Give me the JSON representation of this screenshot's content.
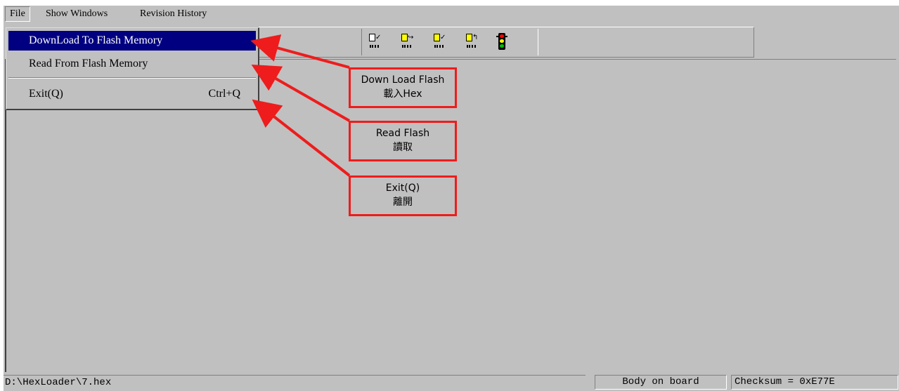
{
  "menubar": {
    "items": [
      {
        "label": "File"
      },
      {
        "label": "Show Windows"
      },
      {
        "label": "Revision History"
      }
    ]
  },
  "file_menu": {
    "items": [
      {
        "label": "DownLoad To Flash Memory",
        "shortcut": ""
      },
      {
        "label": "Read From Flash Memory",
        "shortcut": ""
      },
      {
        "label": "Exit(Q)",
        "shortcut": "Ctrl+Q"
      }
    ],
    "selected_index": 0
  },
  "toolbar": {
    "buttons": [
      {
        "icon": "download-flash-icon"
      },
      {
        "icon": "load-file-icon"
      },
      {
        "icon": "verify-flash-icon"
      },
      {
        "icon": "read-flash-icon"
      },
      {
        "icon": "traffic-light-icon"
      }
    ]
  },
  "statusbar": {
    "path": "D:\\HexLoader\\7.hex",
    "board_status": "Body on board",
    "checksum": "Checksum = 0xE77E"
  },
  "annotations": [
    {
      "line1": "Down Load Flash",
      "line2": "載入Hex"
    },
    {
      "line1": "Read Flash",
      "line2": "讀取"
    },
    {
      "line1": "Exit(Q)",
      "line2": "離開"
    }
  ],
  "colors": {
    "face": "#c0c0c0",
    "highlight": "#000080",
    "annotation": "#ee1c1c"
  }
}
